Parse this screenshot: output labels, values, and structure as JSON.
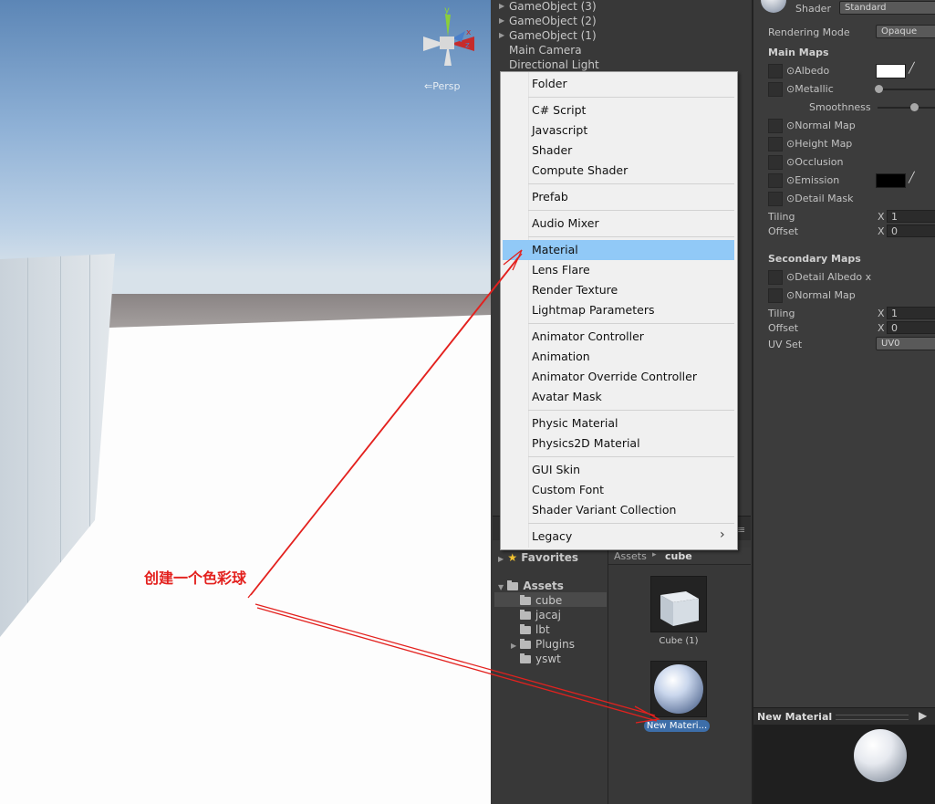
{
  "hierarchy": {
    "items": [
      "GameObject (3)",
      "GameObject (2)",
      "GameObject (1)",
      "Main Camera",
      "Directional Light"
    ]
  },
  "scene": {
    "persp_label": "Persp",
    "gizmo_axes": {
      "y": "y",
      "x": "x",
      "z": "z"
    }
  },
  "context_menu": {
    "groups": [
      [
        "Folder"
      ],
      [
        "C# Script",
        "Javascript",
        "Shader",
        "Compute Shader"
      ],
      [
        "Prefab"
      ],
      [
        "Audio Mixer"
      ],
      [
        "Material",
        "Lens Flare",
        "Render Texture",
        "Lightmap Parameters"
      ],
      [
        "Animator Controller",
        "Animation",
        "Animator Override Controller",
        "Avatar Mask"
      ],
      [
        "Physic Material",
        "Physics2D Material"
      ],
      [
        "GUI Skin",
        "Custom Font",
        "Shader Variant Collection"
      ],
      [
        "Legacy"
      ]
    ],
    "highlighted": "Material",
    "submenu_arrow": "›"
  },
  "project": {
    "favorites_label": "Favorites",
    "assets_label": "Assets",
    "folders": [
      "cube",
      "jacaj",
      "lbt",
      "Plugins",
      "yswt"
    ],
    "selected_folder": "cube",
    "breadcrumb": {
      "root": "Assets",
      "separator": "▸",
      "current": "cube"
    },
    "assets": [
      {
        "label": "Cube (1)",
        "icon": "cube-icon"
      },
      {
        "label": "New Materi...",
        "icon": "material-sphere-icon",
        "selected": true
      }
    ]
  },
  "inspector": {
    "shader_label": "Shader",
    "shader_value": "Standard",
    "rendering_mode_label": "Rendering Mode",
    "rendering_mode_value": "Opaque",
    "main_maps_label": "Main Maps",
    "albedo": "Albedo",
    "metallic": "Metallic",
    "smoothness": "Smoothness",
    "normal_map": "Normal Map",
    "height_map": "Height Map",
    "occlusion": "Occlusion",
    "emission": "Emission",
    "detail_mask": "Detail Mask",
    "tiling_label": "Tiling",
    "offset_label": "Offset",
    "x_label": "X",
    "tiling_x": "1",
    "offset_x": "0",
    "secondary_maps_label": "Secondary Maps",
    "detail_albedo": "Detail Albedo x",
    "normal_map_2": "Normal Map",
    "tiling_x_2": "1",
    "offset_x_2": "0",
    "uv_set_label": "UV Set",
    "uv_set_value": "UV0",
    "preview_title": "New Material",
    "colors": {
      "albedo": "#ffffff",
      "emission": "#000000"
    }
  },
  "annotation": {
    "text": "创建一个色彩球",
    "color": "#e3211e"
  }
}
